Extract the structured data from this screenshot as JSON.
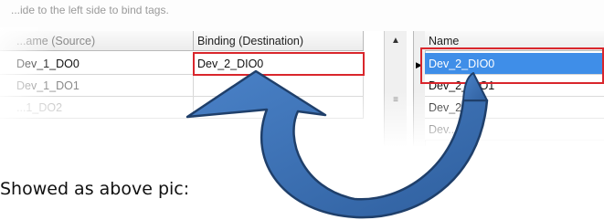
{
  "instruction": "...ide to the left side to bind tags.",
  "left_table": {
    "headers": [
      "...ame (Source)",
      "Binding (Destination)"
    ],
    "rows": [
      {
        "source": "Dev_1_DO0",
        "binding": "Dev_2_DIO0"
      },
      {
        "source": "Dev_1_DO1",
        "binding": ""
      },
      {
        "source": "...1_DO2",
        "binding": ""
      }
    ],
    "scroll_up_icon": "triangle-up-icon",
    "scroll_grip_icon": "grip-lines-icon"
  },
  "right_table": {
    "header": "Name",
    "rows": [
      "Dev_2_DIO0",
      "Dev_2_DIO1",
      "Dev_2...",
      "Dev..."
    ],
    "selected_index": 0,
    "row_pointer_icon": "triangle-right-icon"
  },
  "highlight_color": "#d9262c",
  "selection_color": "#3f8ee8",
  "arrow_color": "#3c6fb3",
  "caption": "Showed as above pic:"
}
